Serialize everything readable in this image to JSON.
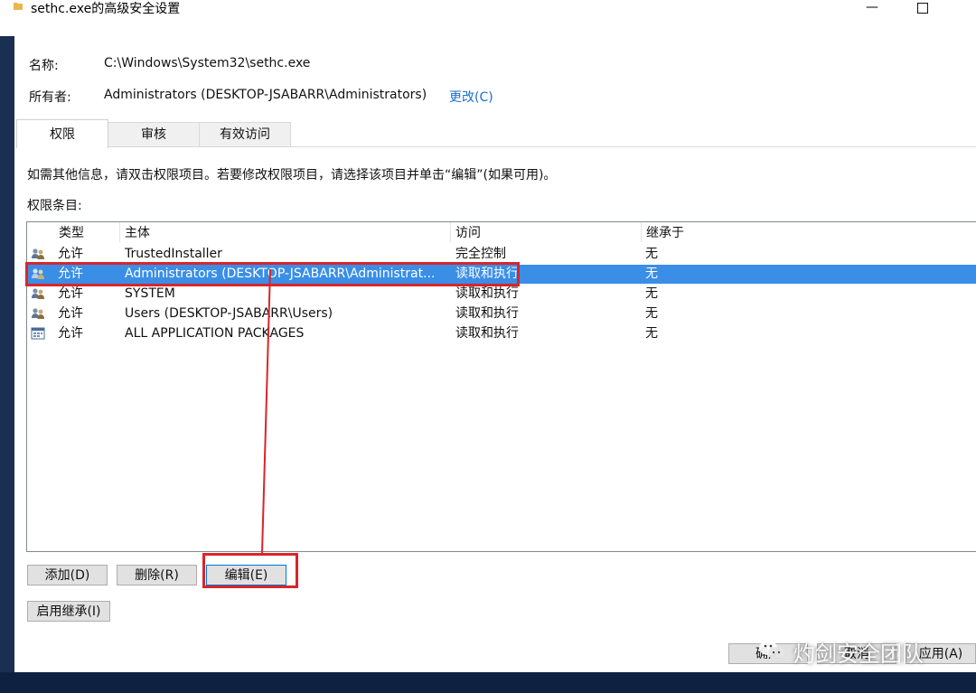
{
  "window": {
    "title": "sethc.exe的高级安全设置"
  },
  "fields": {
    "name_label": "名称:",
    "name_value": "C:\\Windows\\System32\\sethc.exe",
    "owner_label": "所有者:",
    "owner_value": "Administrators (DESKTOP-JSABARR\\Administrators)",
    "change_link": "更改(C)"
  },
  "tabs": [
    {
      "label": "权限",
      "active": true
    },
    {
      "label": "审核",
      "active": false
    },
    {
      "label": "有效访问",
      "active": false
    }
  ],
  "info_text": "如需其他信息，请双击权限项目。若要修改权限项目，请选择该项目并单击“编辑”(如果可用)。",
  "entries_label": "权限条目:",
  "table": {
    "headers": [
      "类型",
      "主体",
      "访问",
      "继承于"
    ],
    "rows": [
      {
        "type": "允许",
        "principal": "TrustedInstaller",
        "access": "完全控制",
        "inherited": "无",
        "icon": "users-icon",
        "selected": false
      },
      {
        "type": "允许",
        "principal": "Administrators (DESKTOP-JSABARR\\Administrat...",
        "access": "读取和执行",
        "inherited": "无",
        "icon": "users-icon",
        "selected": true
      },
      {
        "type": "允许",
        "principal": "SYSTEM",
        "access": "读取和执行",
        "inherited": "无",
        "icon": "users-icon",
        "selected": false
      },
      {
        "type": "允许",
        "principal": "Users (DESKTOP-JSABARR\\Users)",
        "access": "读取和执行",
        "inherited": "无",
        "icon": "users-icon",
        "selected": false
      },
      {
        "type": "允许",
        "principal": "ALL APPLICATION PACKAGES",
        "access": "读取和执行",
        "inherited": "无",
        "icon": "app-packages-icon",
        "selected": false
      }
    ]
  },
  "buttons": {
    "add": "添加(D)",
    "remove": "删除(R)",
    "edit": "编辑(E)",
    "enable_inheritance": "启用继承(I)",
    "ok": "确定",
    "cancel": "取消",
    "apply": "应用(A)"
  },
  "watermark": "灼剑安全团队",
  "colors": {
    "selection": "#3a8ee6",
    "highlight": "#d9252b",
    "link": "#1a6fc9"
  }
}
